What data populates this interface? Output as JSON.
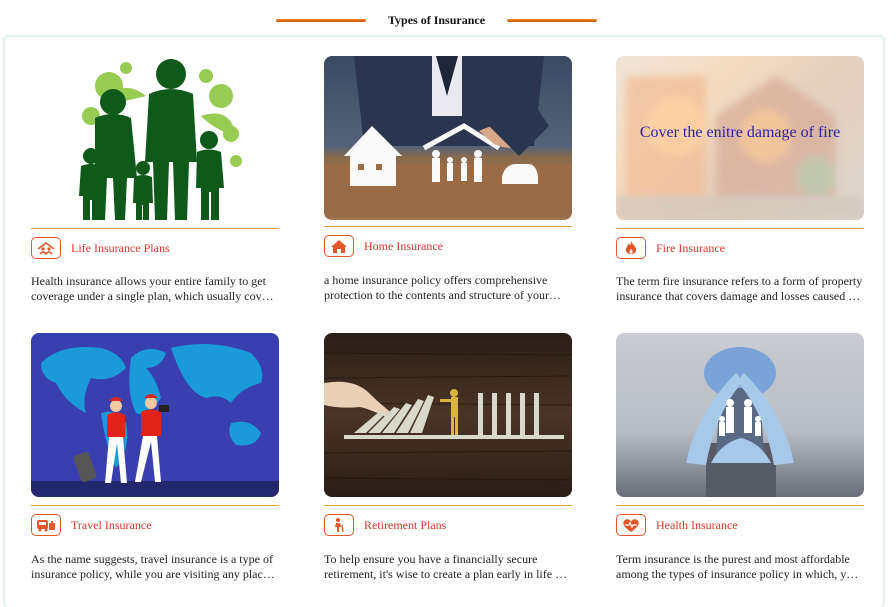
{
  "section": {
    "title": "Types of Insurance"
  },
  "cards": [
    {
      "title": "Life Insurance Plans",
      "desc_line1": "Health insurance allows your entire family to get",
      "desc_line2": "coverage under a single plan, which usually cov…",
      "icon": "family-shield-icon"
    },
    {
      "title": "Home Insurance",
      "desc_line1": "a home insurance policy offers comprehensive",
      "desc_line2": "protection to the contents and structure of your…",
      "icon": "house-icon"
    },
    {
      "title": "Fire Insurance",
      "desc_line1": "The term fire insurance refers to a form of property",
      "desc_line2": "insurance that covers damage and losses caused …",
      "icon": "flame-icon",
      "overlay": "Cover the enitre damage of fire"
    },
    {
      "title": "Travel Insurance",
      "desc_line1": "As the name suggests, travel insurance is a type of",
      "desc_line2": "insurance policy, while you are visiting any plac…",
      "icon": "bus-luggage-icon"
    },
    {
      "title": "Retirement Plans",
      "desc_line1": "To help ensure you have a financially secure",
      "desc_line2": "retirement, it's wise to create a plan early in life …",
      "icon": "elderly-person-icon"
    },
    {
      "title": "Health Insurance",
      "desc_line1": "Term insurance is the purest and most affordable",
      "desc_line2": "among the types of insurance policy in which, y…",
      "icon": "heart-pulse-icon"
    }
  ],
  "colors": {
    "accent": "#e2572a",
    "title": "#d9342a",
    "rule": "#e0a030"
  }
}
